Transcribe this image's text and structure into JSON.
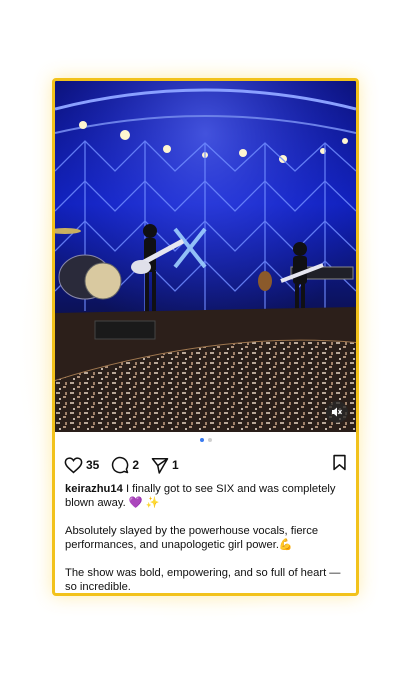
{
  "post": {
    "media": {
      "carousel_count": 2,
      "active_index": 0,
      "mute_icon": "speaker-muted-icon"
    },
    "actions": {
      "like_count": "35",
      "comment_count": "2",
      "share_count": "1",
      "like_icon": "heart-icon",
      "comment_icon": "comment-bubble-icon",
      "share_icon": "paper-plane-icon",
      "save_icon": "bookmark-icon"
    },
    "caption": {
      "username": "keirazhu14",
      "line1": " I finally got to see SIX and was completely blown away. 💜 ✨",
      "line2": "Absolutely slayed by the powerhouse vocals, fierce performances, and unapologetic girl power.💪",
      "line3": "The show was bold, empowering, and so full of heart — so incredible."
    },
    "colors": {
      "card_border": "#f2c21b",
      "dot_active": "#3a7bf0",
      "stage_blue": "#1a3cff"
    }
  }
}
